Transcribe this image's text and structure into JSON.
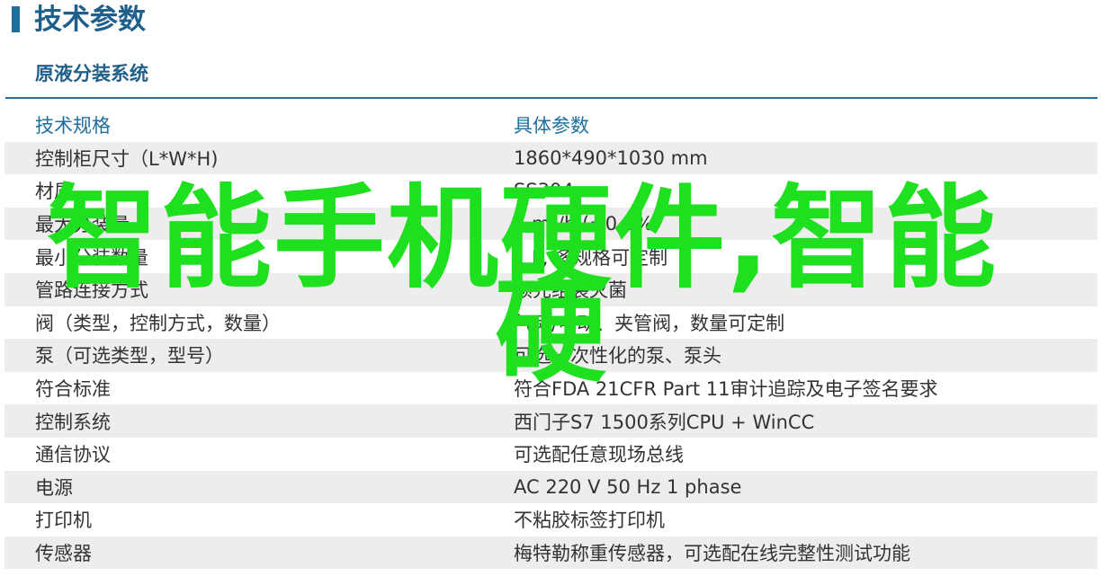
{
  "header": {
    "title": "技术参数",
    "section": "原液分装系统"
  },
  "table": {
    "columns": [
      "技术规格",
      "具体参数"
    ],
    "rows": [
      [
        "控制柜尺寸（L*W*H)",
        "1860*490*1030 mm"
      ],
      [
        "材质",
        "SS304"
      ],
      [
        "最大分装量",
        "5 m³/h (±0.5%)"
      ],
      [
        "最小分装数量",
        "1 L, 多规格可定制"
      ],
      [
        "管路连接方式",
        "预先组装灭菌"
      ],
      [
        "阀（类型，控制方式，数量）",
        "气动/电动、夹管阀，数量可定制"
      ],
      [
        "泵（可选类型，型号）",
        "可选一次性化的泵、泵头"
      ],
      [
        "符合标准",
        "符合FDA 21CFR Part 11审计追踪及电子签名要求"
      ],
      [
        "控制系统",
        "西门子S7 1500系列CPU + WinCC"
      ],
      [
        "通信协议",
        "可选配任意现场总线"
      ],
      [
        "电源",
        "AC 220 V 50 Hz 1 phase"
      ],
      [
        "打印机",
        "不粘胶标签打印机"
      ],
      [
        "传感器",
        "梅特勒称重传感器，可选配在线完整性测试功能"
      ]
    ]
  },
  "overlay": {
    "line1": "智能手机硬件,智能",
    "line2": "硬",
    "color": "#1fe01f"
  }
}
